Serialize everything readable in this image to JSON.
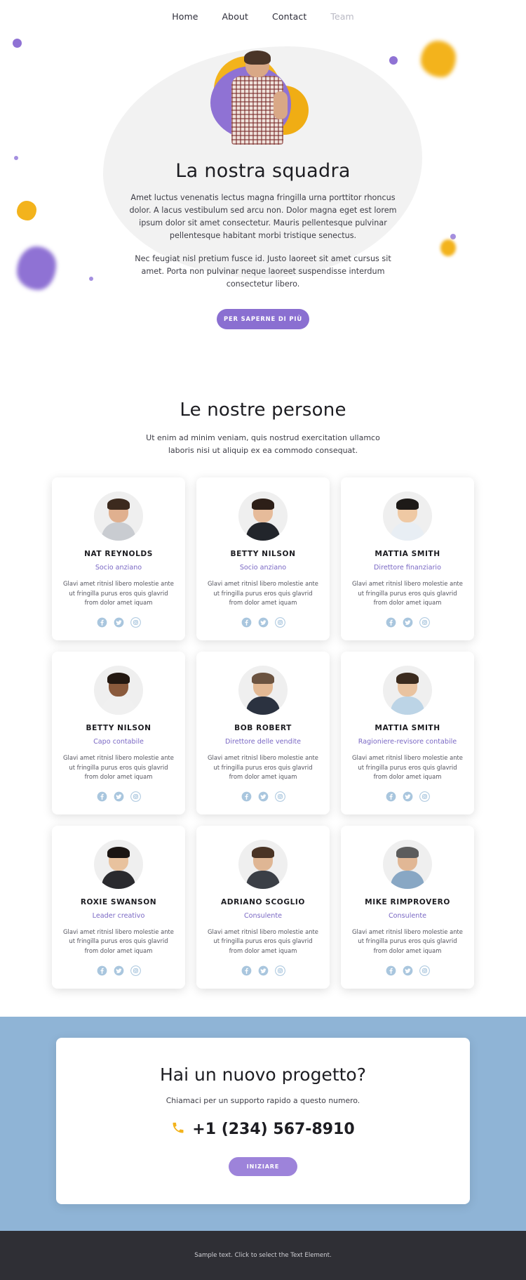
{
  "nav": {
    "items": [
      {
        "label": "Home",
        "active": false
      },
      {
        "label": "About",
        "active": false
      },
      {
        "label": "Contact",
        "active": false
      },
      {
        "label": "Team",
        "active": true
      }
    ]
  },
  "hero": {
    "title": "La nostra squadra",
    "paragraph1": "Amet luctus venenatis lectus magna fringilla urna porttitor rhoncus dolor. A lacus vestibulum sed arcu non. Dolor magna eget est lorem ipsum dolor sit amet consectetur. Mauris pellentesque pulvinar pellentesque habitant morbi tristique senectus.",
    "paragraph2": "Nec feugiat nisl pretium fusce id. Justo laoreet sit amet cursus sit amet. Porta non pulvinar neque laoreet suspendisse interdum consectetur libero.",
    "button_label": "PER SAPERNE DI PIÙ"
  },
  "team": {
    "title": "Le nostre persone",
    "subtitle": "Ut enim ad minim veniam, quis nostrud exercitation ullamco laboris nisi ut aliquip ex ea commodo consequat.",
    "shared_description": "Glavi amet ritnisl libero molestie ante ut fringilla purus eros quis glavrid from dolor amet iquam",
    "social_icons": [
      "facebook-icon",
      "twitter-icon",
      "instagram-icon"
    ],
    "members": [
      {
        "name": "NAT REYNOLDS",
        "role": "Socio anziano",
        "description": "Glavi amet ritnisl libero molestie ante ut fringilla purus eros quis glavrid from dolor amet iquam"
      },
      {
        "name": "BETTY NILSON",
        "role": "Socio anziano",
        "description": "Glavi amet ritnisl libero molestie ante ut fringilla purus eros quis glavrid from dolor amet iquam"
      },
      {
        "name": "MATTIA SMITH",
        "role": "Direttore finanziario",
        "description": "Glavi amet ritnisl libero molestie ante ut fringilla purus eros quis glavrid from dolor amet iquam"
      },
      {
        "name": "BETTY NILSON",
        "role": "Capo contabile",
        "description": "Glavi amet ritnisl libero molestie ante ut fringilla purus eros quis glavrid from dolor amet iquam"
      },
      {
        "name": "BOB ROBERT",
        "role": "Direttore delle vendite",
        "description": "Glavi amet ritnisl libero molestie ante ut fringilla purus eros quis glavrid from dolor amet iquam"
      },
      {
        "name": "MATTIA SMITH",
        "role": "Ragioniere-revisore contabile",
        "description": "Glavi amet ritnisl libero molestie ante ut fringilla purus eros quis glavrid from dolor amet iquam"
      },
      {
        "name": "ROXIE SWANSON",
        "role": "Leader creativo",
        "description": "Glavi amet ritnisl libero molestie ante ut fringilla purus eros quis glavrid from dolor amet iquam"
      },
      {
        "name": "ADRIANO SCOGLIO",
        "role": "Consulente",
        "description": "Glavi amet ritnisl libero molestie ante ut fringilla purus eros quis glavrid from dolor amet iquam"
      },
      {
        "name": "MIKE RIMPROVERO",
        "role": "Consulente",
        "description": "Glavi amet ritnisl libero molestie ante ut fringilla purus eros quis glavrid from dolor amet iquam"
      }
    ]
  },
  "cta": {
    "title": "Hai un nuovo progetto?",
    "subtitle": "Chiamaci per un supporto rapido a questo numero.",
    "phone_icon": "phone-icon",
    "phone": "+1 (234) 567-8910",
    "button_label": "INIZIARE"
  },
  "footer": {
    "text": "Sample text. Click to select the Text Element."
  },
  "colors": {
    "accent_purple": "#8a6fd1",
    "role_purple": "#7a68c4",
    "cta_band_blue": "#8fb4d6",
    "cta_button": "#9d83da",
    "footer_bg": "#2f2f35",
    "social_icon": "#a9c6de",
    "yellow_blob": "#f3b31c"
  }
}
